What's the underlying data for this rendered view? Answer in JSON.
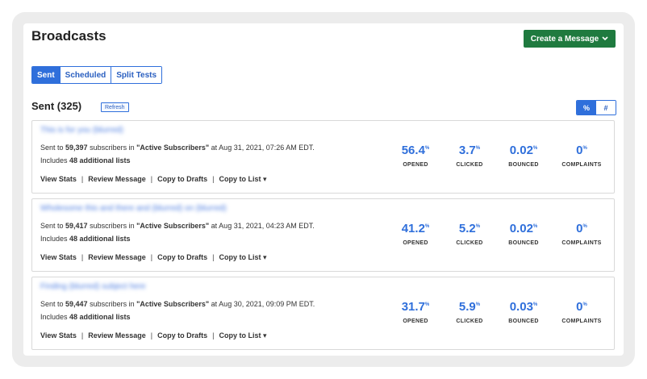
{
  "page": {
    "title": "Broadcasts",
    "create_button": "Create a Message",
    "tabs": [
      {
        "label": "Sent",
        "active": true
      },
      {
        "label": "Scheduled",
        "active": false
      },
      {
        "label": "Split Tests",
        "active": false
      }
    ],
    "sent_heading": "Sent (325)",
    "refresh_label": "Refresh",
    "toggle": [
      {
        "label": "%",
        "active": true
      },
      {
        "label": "#",
        "active": false
      }
    ],
    "accent_color": "#2f6fdb",
    "create_color": "#1f7a3f"
  },
  "broadcasts": [
    {
      "subject": "This is for you (blurred)",
      "sent_prefix": "Sent to ",
      "count": "59,397",
      "mid": " subscribers in ",
      "list": "\"Active Subscribers\"",
      "date": " at Aug 31, 2021, 07:26 AM EDT.",
      "includes_prefix": "Includes ",
      "includes_count": "48 additional lists",
      "actions": {
        "view": "View Stats",
        "review": "Review Message",
        "drafts": "Copy to Drafts",
        "copy_list": "Copy to List ▾",
        "sep": "|"
      },
      "stats": {
        "opened": {
          "value": "56.4",
          "unit": "%",
          "label": "OPENED"
        },
        "clicked": {
          "value": "3.7",
          "unit": "%",
          "label": "CLICKED"
        },
        "bounced": {
          "value": "0.02",
          "unit": "%",
          "label": "BOUNCED"
        },
        "complaints": {
          "value": "0",
          "unit": "%",
          "label": "COMPLAINTS"
        }
      }
    },
    {
      "subject": "Wholesome this and there and (blurred) on (blurred)",
      "sent_prefix": "Sent to ",
      "count": "59,417",
      "mid": " subscribers in ",
      "list": "\"Active Subscribers\"",
      "date": " at Aug 31, 2021, 04:23 AM EDT.",
      "includes_prefix": "Includes ",
      "includes_count": "48 additional lists",
      "actions": {
        "view": "View Stats",
        "review": "Review Message",
        "drafts": "Copy to Drafts",
        "copy_list": "Copy to List ▾",
        "sep": "|"
      },
      "stats": {
        "opened": {
          "value": "41.2",
          "unit": "%",
          "label": "OPENED"
        },
        "clicked": {
          "value": "5.2",
          "unit": "%",
          "label": "CLICKED"
        },
        "bounced": {
          "value": "0.02",
          "unit": "%",
          "label": "BOUNCED"
        },
        "complaints": {
          "value": "0",
          "unit": "%",
          "label": "COMPLAINTS"
        }
      }
    },
    {
      "subject": "Finding (blurred) subject here",
      "sent_prefix": "Sent to ",
      "count": "59,447",
      "mid": " subscribers in ",
      "list": "\"Active Subscribers\"",
      "date": " at Aug 30, 2021, 09:09 PM EDT.",
      "includes_prefix": "Includes ",
      "includes_count": "48 additional lists",
      "actions": {
        "view": "View Stats",
        "review": "Review Message",
        "drafts": "Copy to Drafts",
        "copy_list": "Copy to List ▾",
        "sep": "|"
      },
      "stats": {
        "opened": {
          "value": "31.7",
          "unit": "%",
          "label": "OPENED"
        },
        "clicked": {
          "value": "5.9",
          "unit": "%",
          "label": "CLICKED"
        },
        "bounced": {
          "value": "0.03",
          "unit": "%",
          "label": "BOUNCED"
        },
        "complaints": {
          "value": "0",
          "unit": "%",
          "label": "COMPLAINTS"
        }
      }
    }
  ]
}
